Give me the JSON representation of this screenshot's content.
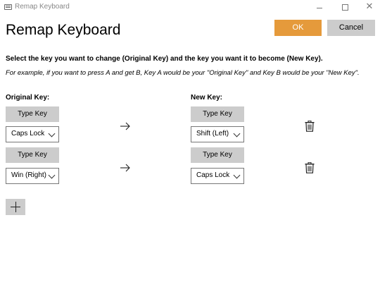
{
  "window": {
    "title": "Remap Keyboard",
    "close_glyph": "✕"
  },
  "page": {
    "title": "Remap Keyboard"
  },
  "actions": {
    "ok_label": "OK",
    "cancel_label": "Cancel"
  },
  "instructions": {
    "primary": "Select the key you want to change (Original Key) and the key you want it to become (New Key).",
    "example": "For example, if you want to press A and get B, Key A would be your \"Original Key\" and Key B would be your \"New Key\"."
  },
  "columns": {
    "original": "Original Key:",
    "new": "New Key:"
  },
  "mappings": [
    {
      "original": {
        "type_key_label": "Type Key",
        "selected": "Caps Lock"
      },
      "new": {
        "type_key_label": "Type Key",
        "selected": "Shift (Left)"
      }
    },
    {
      "original": {
        "type_key_label": "Type Key",
        "selected": "Win (Right)"
      },
      "new": {
        "type_key_label": "Type Key",
        "selected": "Caps Lock"
      }
    }
  ],
  "icons": {
    "arrow": "arrow-right-icon",
    "delete": "trash-icon",
    "add": "plus-icon"
  },
  "colors": {
    "accent": "#e59a3b",
    "button_gray": "#cccccc"
  }
}
